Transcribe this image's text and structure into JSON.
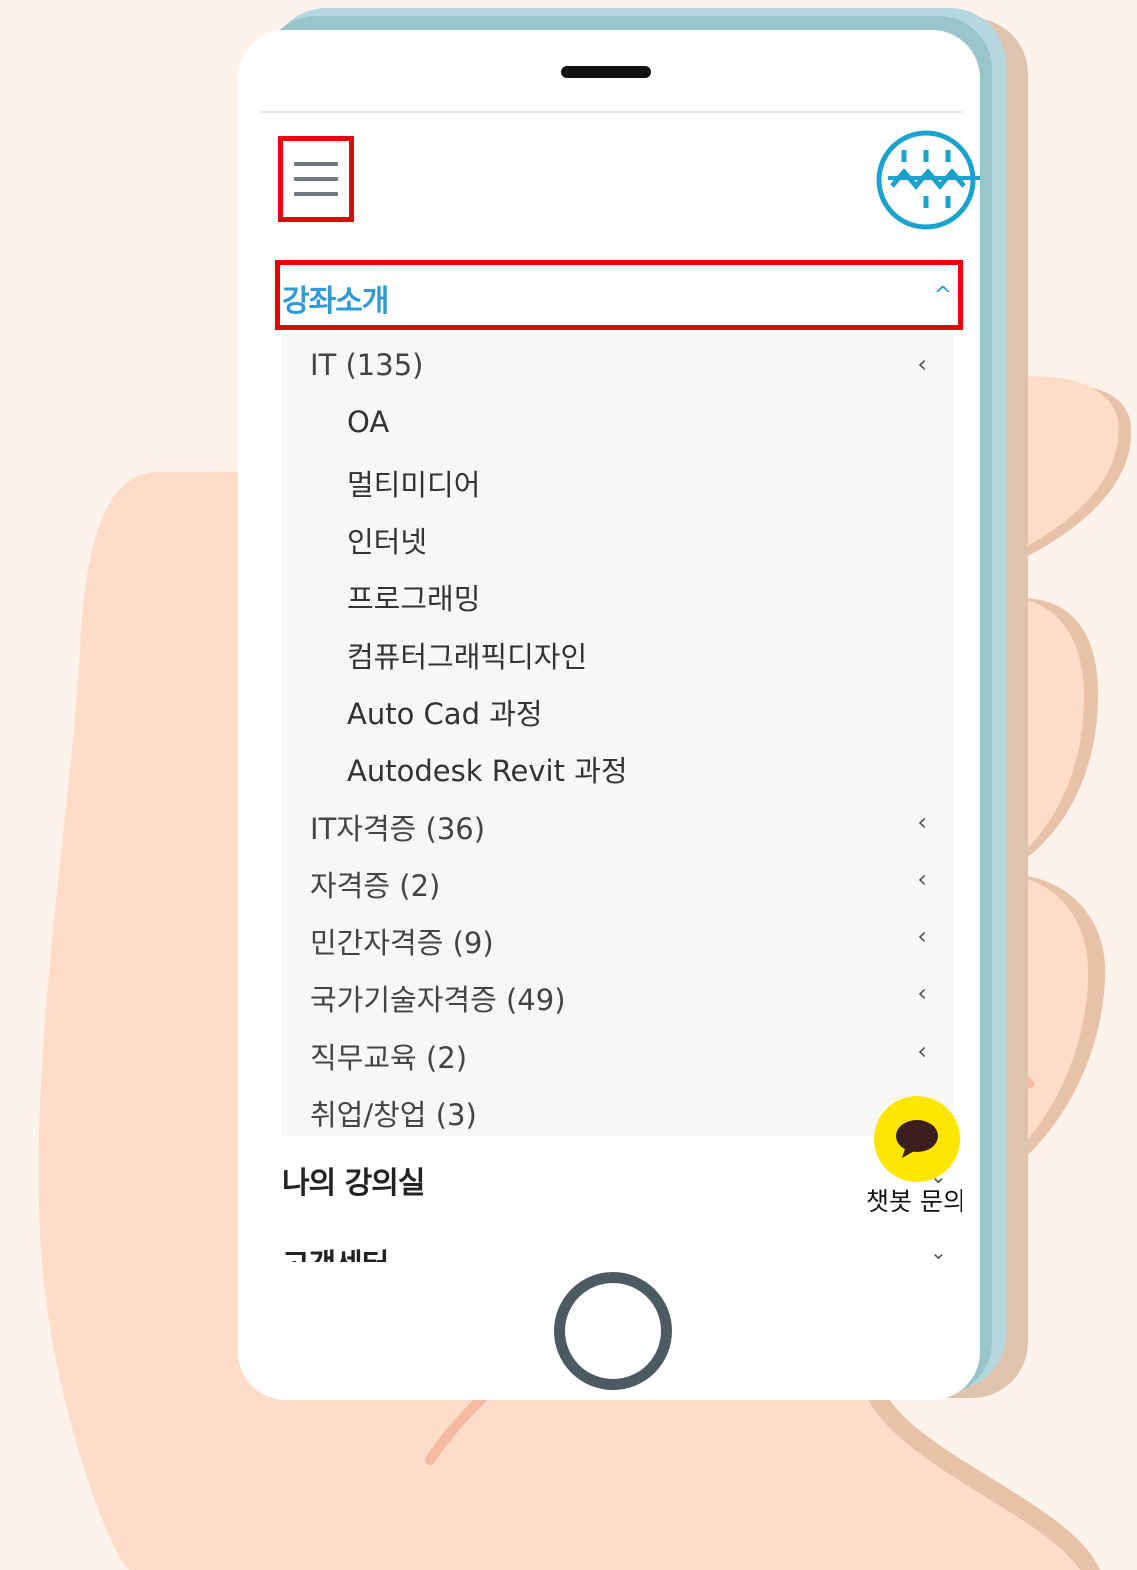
{
  "colors": {
    "background": "#fdf3ea",
    "hand": "#fddcc8",
    "highlight_border": "#e8000b",
    "accent_blue": "#2e9ad8",
    "chat_yellow": "#ffe600"
  },
  "header": {
    "menu_icon": "hamburger-menu-icon",
    "logo_icon": "wave-circle-logo"
  },
  "nav": {
    "open_section": {
      "label": "강좌소개",
      "icon": "chevron-up-icon"
    },
    "categories": [
      {
        "label": "IT (135)",
        "icon": "chevron-left-icon",
        "children": [
          "OA",
          "멀티미디어",
          "인터넷",
          "프로그래밍",
          "컴퓨터그래픽디자인",
          "Auto Cad 과정",
          "Autodesk Revit 과정"
        ]
      },
      {
        "label": "IT자격증 (36)",
        "icon": "chevron-left-icon"
      },
      {
        "label": "자격증 (2)",
        "icon": "chevron-left-icon"
      },
      {
        "label": "민간자격증 (9)",
        "icon": "chevron-left-icon"
      },
      {
        "label": "국가기술자격증 (49)",
        "icon": "chevron-left-icon"
      },
      {
        "label": "직무교육 (2)",
        "icon": "chevron-left-icon"
      },
      {
        "label": "취업/창업 (3)"
      }
    ],
    "sections": [
      {
        "label": "나의 강의실",
        "icon": "chevron-down-icon"
      },
      {
        "label": "고객센터",
        "icon": "chevron-down-icon"
      }
    ]
  },
  "chatbot": {
    "label": "챗봇 문의",
    "icon": "chat-bubble-icon"
  }
}
